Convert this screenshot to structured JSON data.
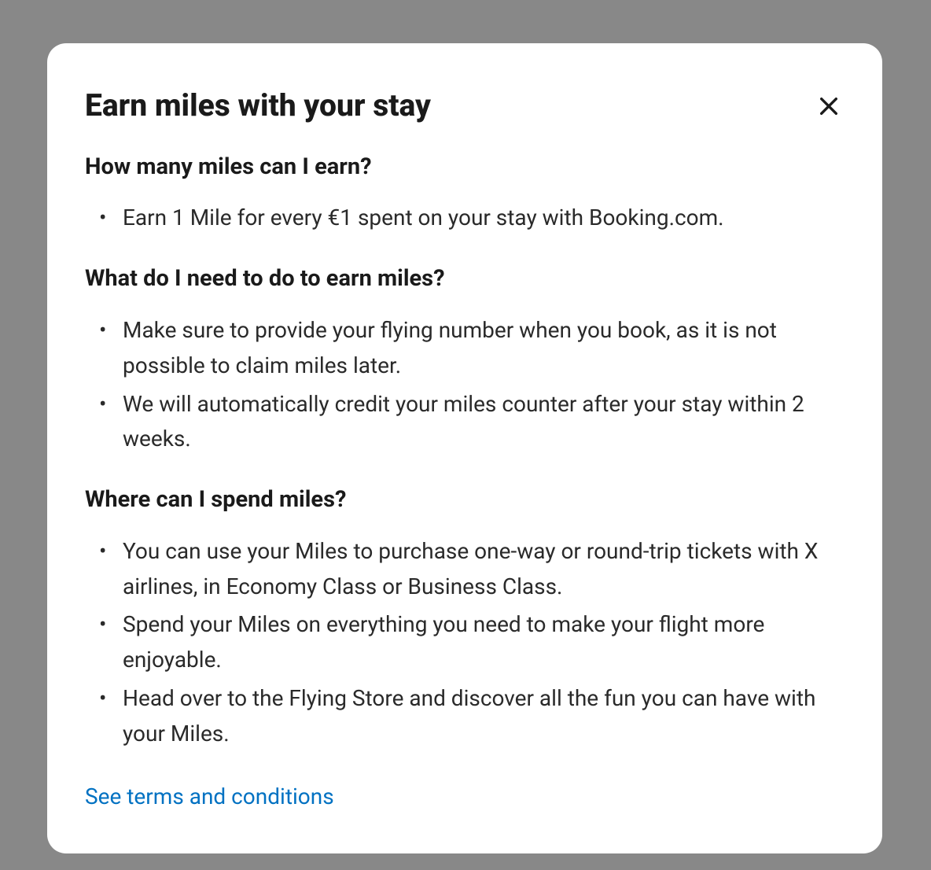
{
  "modal": {
    "title": "Earn miles with your stay",
    "sections": [
      {
        "heading": "How many miles can I earn?",
        "items": [
          "Earn 1 Mile for every €1 spent on your stay with Booking.com."
        ]
      },
      {
        "heading": "What do I need to do to earn miles?",
        "items": [
          "Make sure to provide your flying number when you book, as it is not possible to claim miles later.",
          "We will automatically credit your miles counter after your stay within 2 weeks."
        ]
      },
      {
        "heading": "Where can I spend miles?",
        "items": [
          "You can use your Miles to purchase one-way or round-trip tickets with X airlines, in Economy Class or Business Class.",
          "Spend your Miles on everything you need to make your flight more enjoyable.",
          "Head over to the Flying Store and discover all the fun you can have with your Miles."
        ]
      }
    ],
    "terms_link": "See terms and conditions"
  }
}
